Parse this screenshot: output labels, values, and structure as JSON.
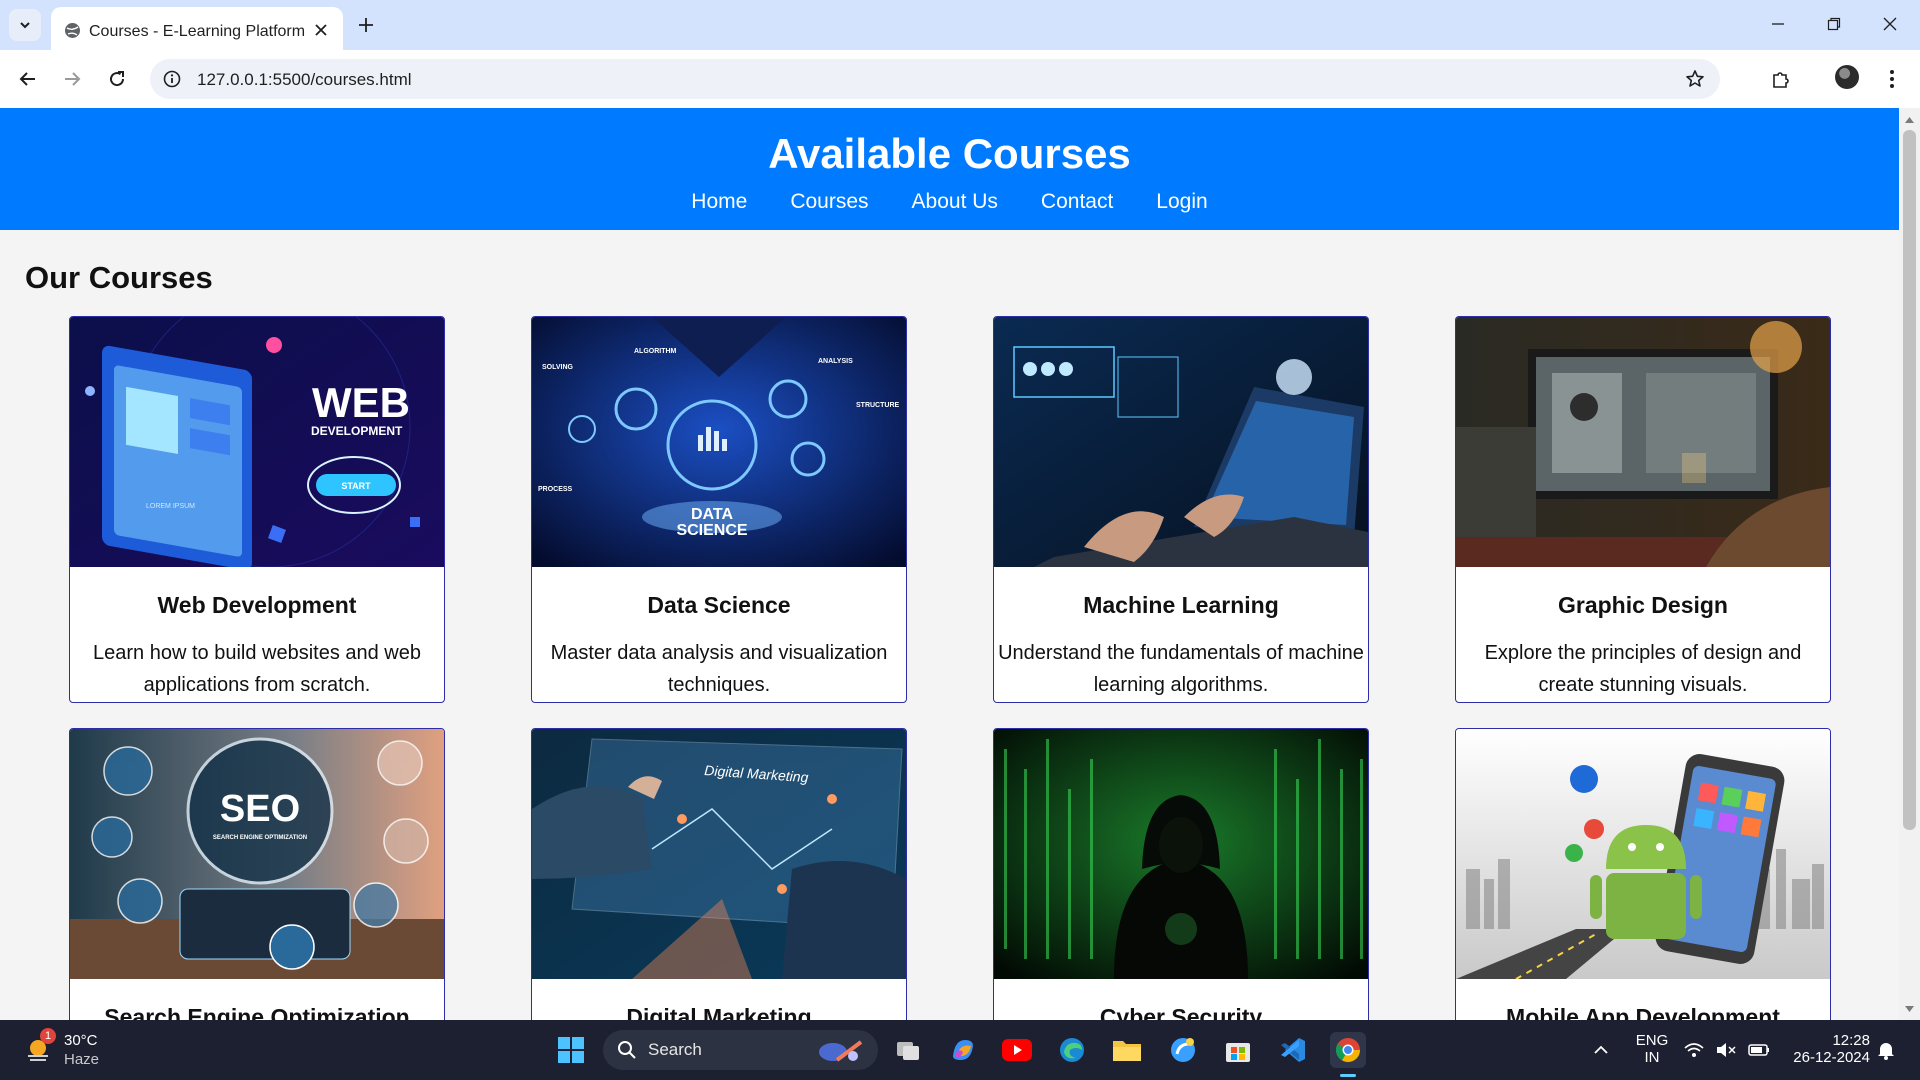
{
  "browser": {
    "tab_title": "Courses - E-Learning Platform",
    "url": "127.0.0.1:5500/courses.html"
  },
  "site": {
    "title": "Available Courses",
    "nav": [
      "Home",
      "Courses",
      "About Us",
      "Contact",
      "Login"
    ],
    "section_title": "Our Courses",
    "accent_color": "#007bff"
  },
  "courses": [
    {
      "title": "Web Development",
      "description": "Learn how to build websites and web applications from scratch.",
      "image_text": [
        "WEB",
        "DEVELOPMENT",
        "START",
        "LOREM IPSUM"
      ]
    },
    {
      "title": "Data Science",
      "description": "Master data analysis and visualization techniques.",
      "image_text": [
        "ALGORITHM",
        "ANALYSIS",
        "SOLVING",
        "STRUCTURE",
        "PROCESS",
        "DATA",
        "SCIENCE"
      ]
    },
    {
      "title": "Machine Learning",
      "description": "Understand the fundamentals of machine learning algorithms.",
      "image_text": []
    },
    {
      "title": "Graphic Design",
      "description": "Explore the principles of design and create stunning visuals.",
      "image_text": []
    },
    {
      "title": "Search Engine Optimization",
      "description": "",
      "image_text": [
        "SEO",
        "SEARCH ENGINE OPTIMIZATION"
      ]
    },
    {
      "title": "Digital Marketing",
      "description": "",
      "image_text": [
        "Digital Marketing"
      ]
    },
    {
      "title": "Cyber Security",
      "description": "",
      "image_text": []
    },
    {
      "title": "Mobile App Development",
      "description": "",
      "image_text": []
    }
  ],
  "taskbar": {
    "weather_temp": "30°C",
    "weather_desc": "Haze",
    "weather_badge": "1",
    "search_label": "Search",
    "lang": "ENG",
    "region": "IN",
    "time": "12:28",
    "date": "26-12-2024"
  }
}
